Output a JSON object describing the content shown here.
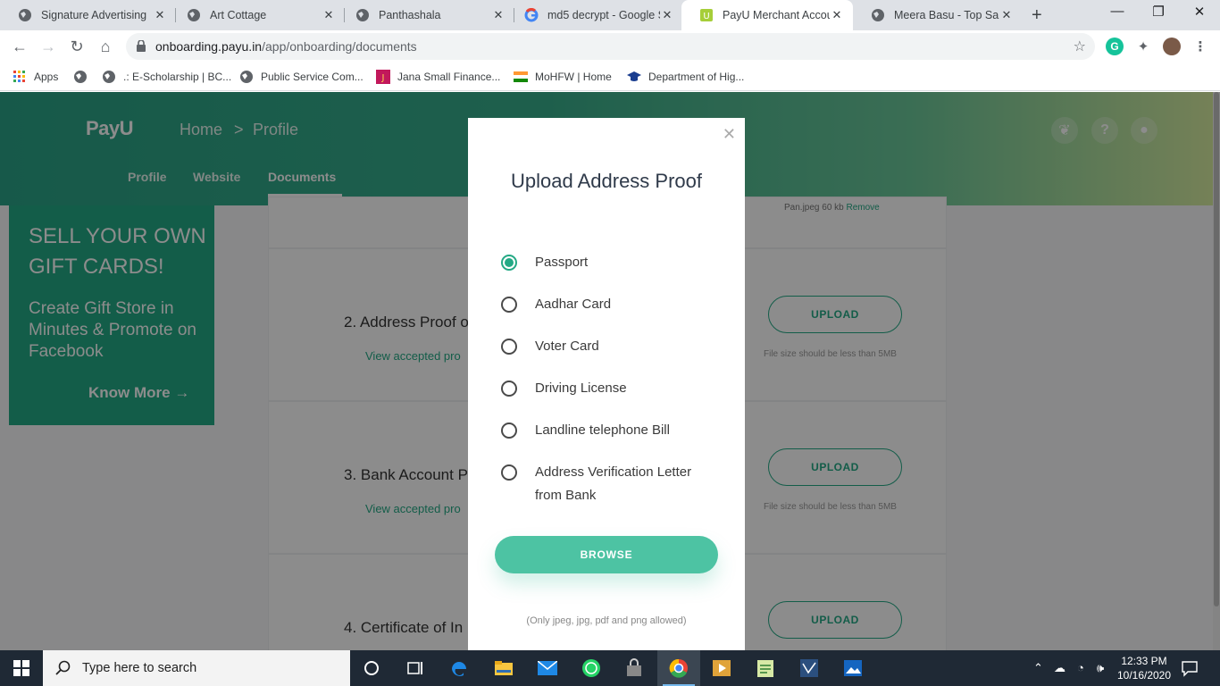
{
  "browser": {
    "tabs": [
      {
        "title": "Signature Advertising",
        "active": false
      },
      {
        "title": "Art Cottage",
        "active": false
      },
      {
        "title": "Panthashala",
        "active": false
      },
      {
        "title": "md5 decrypt - Google S",
        "active": false
      },
      {
        "title": "PayU Merchant Accoun",
        "active": true
      },
      {
        "title": "Meera Basu - Top Saree",
        "active": false
      }
    ],
    "url_domain": "onboarding.payu.in",
    "url_path": "/app/onboarding/documents",
    "bookmarks": [
      "Apps",
      "",
      ".: E-Scholarship | BC...",
      "Public Service Com...",
      "Jana Small Finance...",
      "MoHFW | Home",
      "Department of Hig..."
    ]
  },
  "header": {
    "logo": "PayU",
    "breadcrumb": [
      "Home",
      "Profile"
    ],
    "breadcrumb_sep": ">",
    "subnav": [
      {
        "label": "Profile",
        "active": false
      },
      {
        "label": "Website",
        "active": false
      },
      {
        "label": "Documents",
        "active": true
      }
    ]
  },
  "promo": {
    "heading": "SELL YOUR OWN GIFT CARDS!",
    "body": "Create Gift Store in Minutes & Promote on Facebook",
    "cta": "Know More"
  },
  "documents": {
    "pan_file": "Pan.jpeg 60 kb",
    "remove_label": "Remove",
    "items": [
      {
        "label": "2. Address Proof o",
        "view": "View accepted pro",
        "upload": "UPLOAD",
        "size_note": "File size should be less than 5MB"
      },
      {
        "label": "3. Bank Account P",
        "view": "View accepted pro",
        "upload": "UPLOAD",
        "size_note": "File size should be less than 5MB"
      },
      {
        "label": "4. Certificate of In",
        "view": "",
        "upload": "UPLOAD",
        "size_note": ""
      }
    ]
  },
  "modal": {
    "title": "Upload Address Proof",
    "options": [
      {
        "label": "Passport",
        "selected": true
      },
      {
        "label": "Aadhar Card",
        "selected": false
      },
      {
        "label": "Voter Card",
        "selected": false
      },
      {
        "label": "Driving License",
        "selected": false
      },
      {
        "label": "Landline telephone Bill",
        "selected": false
      },
      {
        "label": "Address Verification Letter from Bank",
        "selected": false
      }
    ],
    "browse_label": "BROWSE",
    "allowed_note": "(Only jpeg, jpg, pdf and png allowed)"
  },
  "taskbar": {
    "search_placeholder": "Type here to search",
    "time": "12:33 PM",
    "date": "10/16/2020"
  },
  "colors": {
    "accent": "#24a985",
    "browse": "#4dc3a3",
    "taskbar": "#1f2935"
  }
}
